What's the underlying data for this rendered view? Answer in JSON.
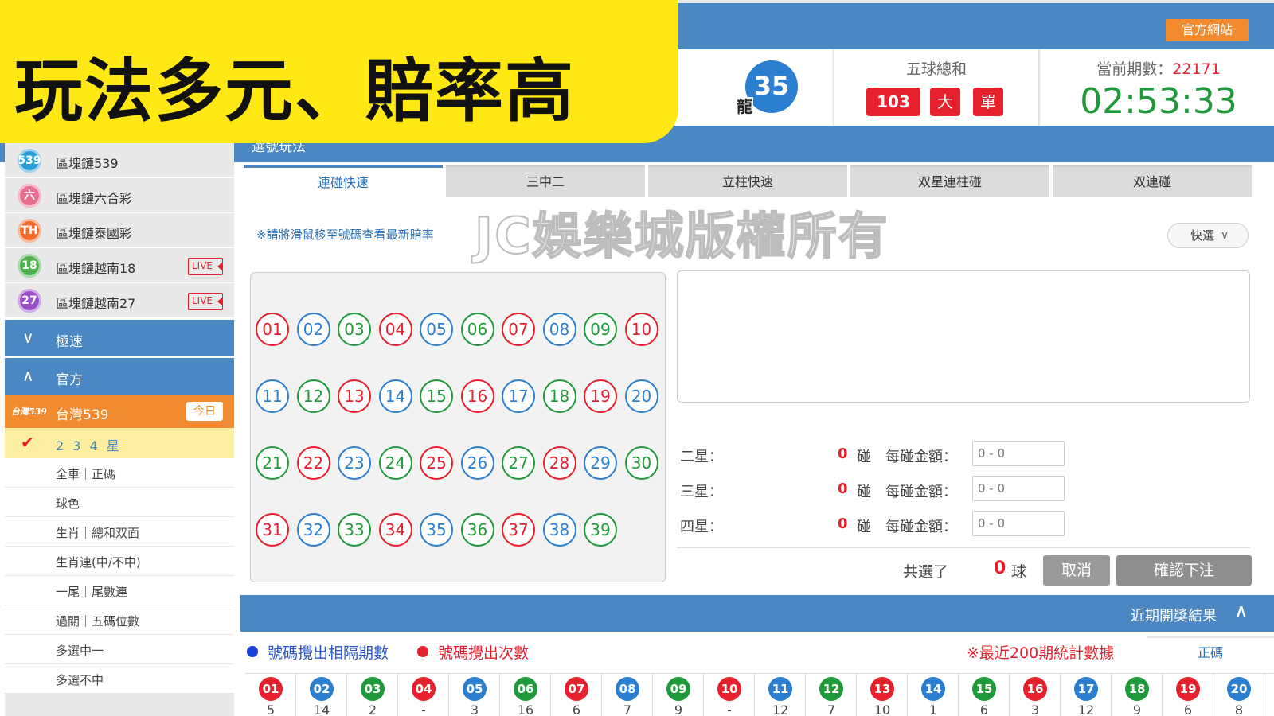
{
  "header": {
    "official_site": "官方網站",
    "dragon_number": "35",
    "dragon_tag": "龍",
    "sum_title": "五球總和",
    "sum_value": "103",
    "sum_big": "大",
    "sum_odd": "單",
    "period_label": "當前期數：",
    "period_number": "22171",
    "countdown": "02:53:33",
    "section_title": "選號玩法"
  },
  "banner": {
    "text": "玩法多元、賠率高"
  },
  "sidebar": {
    "items": [
      {
        "icon": "539",
        "label": "區塊鏈539",
        "color": "#2b9ed8"
      },
      {
        "icon": "六",
        "label": "區塊鏈六合彩",
        "color": "#e86d8f"
      },
      {
        "icon": "TH",
        "label": "區塊鏈泰國彩",
        "color": "#f06b2a"
      },
      {
        "icon": "18",
        "label": "區塊鏈越南18",
        "color": "#4db04a",
        "live": "LIVE"
      },
      {
        "icon": "27",
        "label": "區塊鏈越南27",
        "color": "#9a4fc7",
        "live": "LIVE"
      }
    ],
    "cat_fast": "極速",
    "cat_official": "官方",
    "active_logo": "台灣539",
    "active_label": "台灣539",
    "active_today": "今日",
    "sub_active": "2 3 4 星",
    "subs": [
      "全車｜正碼",
      "球色",
      "生肖｜總和双面",
      "生肖連(中/不中)",
      "一尾｜尾數連",
      "過關｜五碼位數",
      "多選中一",
      "多選不中"
    ]
  },
  "tabs": [
    "連碰快速",
    "三中二",
    "立柱快速",
    "双星連柱碰",
    "双連碰"
  ],
  "hint": "※請將滑鼠移至號碼查看最新賠率",
  "watermark": "JC娛樂城版權所有",
  "quick_select": "快選",
  "numbers": [
    "01",
    "02",
    "03",
    "04",
    "05",
    "06",
    "07",
    "08",
    "09",
    "10",
    "11",
    "12",
    "13",
    "14",
    "15",
    "16",
    "17",
    "18",
    "19",
    "20",
    "21",
    "22",
    "23",
    "24",
    "25",
    "26",
    "27",
    "28",
    "29",
    "30",
    "31",
    "32",
    "33",
    "34",
    "35",
    "36",
    "37",
    "38",
    "39"
  ],
  "number_colors": [
    "r",
    "b",
    "g",
    "r",
    "b",
    "g",
    "r",
    "b",
    "g",
    "r",
    "b",
    "g",
    "r",
    "b",
    "g",
    "r",
    "b",
    "g",
    "r",
    "b",
    "g",
    "r",
    "b",
    "g",
    "r",
    "b",
    "g",
    "r",
    "b",
    "g",
    "r",
    "b",
    "g",
    "r",
    "b",
    "g",
    "r",
    "b",
    "g"
  ],
  "bets": [
    {
      "star": "二星：",
      "count": "0",
      "unit": "碰",
      "amount_label": "每碰金額：",
      "placeholder": "0 - 0"
    },
    {
      "star": "三星：",
      "count": "0",
      "unit": "碰",
      "amount_label": "每碰金額：",
      "placeholder": "0 - 0"
    },
    {
      "star": "四星：",
      "count": "0",
      "unit": "碰",
      "amount_label": "每碰金額：",
      "placeholder": "0 - 0"
    }
  ],
  "total": {
    "label": "共選了",
    "count": "0",
    "unit": "球"
  },
  "buttons": {
    "cancel": "取消",
    "confirm": "確認下注"
  },
  "results": {
    "title": "近期開獎結果",
    "legend_blue": "號碼攪出相隔期數",
    "legend_red": "號碼攪出次數",
    "note": "※最近200期統計數據",
    "tab": "正碼",
    "balls": [
      "01",
      "02",
      "03",
      "04",
      "05",
      "06",
      "07",
      "08",
      "09",
      "10",
      "11",
      "12",
      "13",
      "14",
      "15",
      "16",
      "17",
      "18",
      "19",
      "20"
    ],
    "colors": [
      "r",
      "b",
      "g",
      "r",
      "b",
      "g",
      "r",
      "b",
      "g",
      "r",
      "b",
      "g",
      "r",
      "b",
      "g",
      "r",
      "b",
      "g",
      "r",
      "b"
    ],
    "values": [
      "5",
      "14",
      "2",
      "-",
      "3",
      "16",
      "6",
      "7",
      "9",
      "-",
      "12",
      "7",
      "10",
      "1",
      "6",
      "3",
      "12",
      "9",
      "6",
      "8"
    ]
  }
}
